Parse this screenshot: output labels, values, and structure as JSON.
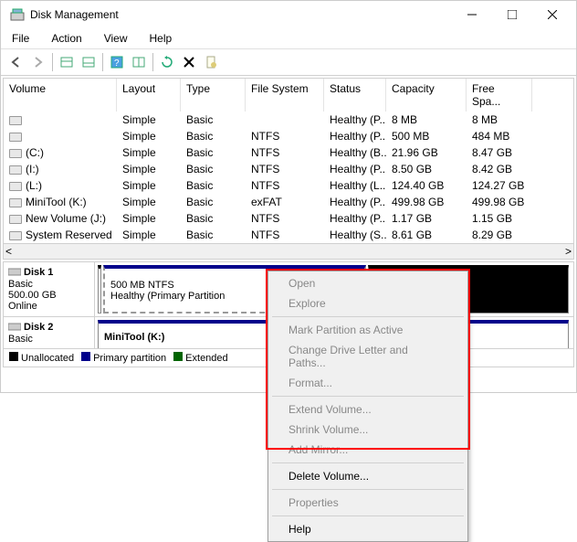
{
  "window": {
    "title": "Disk Management"
  },
  "menubar": [
    "File",
    "Action",
    "View",
    "Help"
  ],
  "columns": [
    "Volume",
    "Layout",
    "Type",
    "File System",
    "Status",
    "Capacity",
    "Free Spa..."
  ],
  "rows": [
    {
      "volume": "",
      "layout": "Simple",
      "type": "Basic",
      "fs": "",
      "status": "Healthy (P...",
      "capacity": "8 MB",
      "free": "8 MB"
    },
    {
      "volume": "",
      "layout": "Simple",
      "type": "Basic",
      "fs": "NTFS",
      "status": "Healthy (P...",
      "capacity": "500 MB",
      "free": "484 MB"
    },
    {
      "volume": "(C:)",
      "layout": "Simple",
      "type": "Basic",
      "fs": "NTFS",
      "status": "Healthy (B...",
      "capacity": "21.96 GB",
      "free": "8.47 GB"
    },
    {
      "volume": "(I:)",
      "layout": "Simple",
      "type": "Basic",
      "fs": "NTFS",
      "status": "Healthy (P...",
      "capacity": "8.50 GB",
      "free": "8.42 GB"
    },
    {
      "volume": "(L:)",
      "layout": "Simple",
      "type": "Basic",
      "fs": "NTFS",
      "status": "Healthy (L...",
      "capacity": "124.40 GB",
      "free": "124.27 GB"
    },
    {
      "volume": "MiniTool (K:)",
      "layout": "Simple",
      "type": "Basic",
      "fs": "exFAT",
      "status": "Healthy (P...",
      "capacity": "499.98 GB",
      "free": "499.98 GB"
    },
    {
      "volume": "New Volume (J:)",
      "layout": "Simple",
      "type": "Basic",
      "fs": "NTFS",
      "status": "Healthy (P...",
      "capacity": "1.17 GB",
      "free": "1.15 GB"
    },
    {
      "volume": "System Reserved",
      "layout": "Simple",
      "type": "Basic",
      "fs": "NTFS",
      "status": "Healthy (S...",
      "capacity": "8.61 GB",
      "free": "8.29 GB"
    }
  ],
  "disks": [
    {
      "name": "Disk 1",
      "type": "Basic",
      "size": "500.00 GB",
      "state": "Online",
      "part_line1": "500 MB NTFS",
      "part_line2": "Healthy (Primary Partition"
    },
    {
      "name": "Disk 2",
      "type": "Basic",
      "size": "",
      "state": "",
      "part_label": "MiniTool (K:)"
    }
  ],
  "legend": [
    {
      "label": "Unallocated",
      "color": "#000"
    },
    {
      "label": "Primary partition",
      "color": "#00008b"
    },
    {
      "label": "Extended",
      "color": "#006400"
    }
  ],
  "context_menu": [
    {
      "label": "Open",
      "disabled": true
    },
    {
      "label": "Explore",
      "disabled": true
    },
    {
      "sep": true
    },
    {
      "label": "Mark Partition as Active",
      "disabled": true
    },
    {
      "label": "Change Drive Letter and Paths...",
      "disabled": true
    },
    {
      "label": "Format...",
      "disabled": true
    },
    {
      "sep": true
    },
    {
      "label": "Extend Volume...",
      "disabled": true
    },
    {
      "label": "Shrink Volume...",
      "disabled": true
    },
    {
      "label": "Add Mirror...",
      "disabled": true
    },
    {
      "sep": true
    },
    {
      "label": "Delete Volume...",
      "disabled": false
    },
    {
      "sep": true
    },
    {
      "label": "Properties",
      "disabled": true
    },
    {
      "sep": true
    },
    {
      "label": "Help",
      "disabled": false
    }
  ]
}
